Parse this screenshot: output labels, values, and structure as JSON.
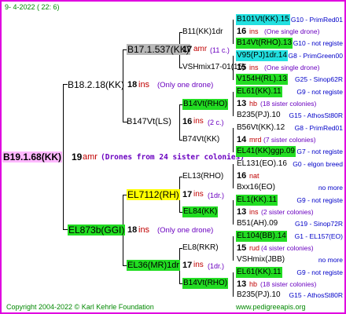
{
  "header": {
    "date": "9-  4-2022 ( 22:  6)"
  },
  "footer": {
    "copyright": "Copyright 2004-2022 © Karl Kehrle Foundation",
    "url": "www.pedigreeapis.org"
  },
  "root": {
    "name": "B19.1.68(KK)",
    "num": "19",
    "tag": "amr",
    "note": "(Drones from 24 sister colonies)"
  },
  "gen2": [
    {
      "name": "B18.2.18(KK)",
      "num": "18",
      "tag": "ins",
      "note": "(Only one drone)"
    },
    {
      "name": "EL873b(GGI)",
      "num": "18",
      "tag": "ins",
      "note": "(Only one drone)"
    }
  ],
  "gen3": [
    {
      "name": "B17.1.537(KK)",
      "num": "17",
      "tag": "amr",
      "note": "(11 c.)"
    },
    {
      "name": "B147Vt(LS)",
      "num": "16",
      "tag": "ins",
      "note": "(2 c.)"
    },
    {
      "name": "EL7112(RH)",
      "num": "17",
      "tag": "ins",
      "note": "(1dr.)"
    },
    {
      "name": "EL36(MR)1dr",
      "num": "17",
      "tag": "ins",
      "note": "(1dr.)"
    }
  ],
  "gen4": [
    {
      "name": "B11(KK)1dr"
    },
    {
      "name": "VSHmix17-01(15)"
    },
    {
      "name": "B14Vt(RHO)"
    },
    {
      "name": "B74Vt(KK)"
    },
    {
      "name": "EL13(RHO)"
    },
    {
      "name": "EL84(KK)"
    },
    {
      "name": "EL8(RKR)"
    },
    {
      "name": "B14Vt(RHO)"
    }
  ],
  "gen5": [
    {
      "name": "B101Vt(KK).15",
      "note": "G10 - PrimRed01"
    },
    {
      "num": "16",
      "tag": "ins",
      "note": "(One single drone)"
    },
    {
      "name": "B14Vt(RHO).13",
      "note": "G10 - not registe"
    },
    {
      "name": "V95(PJ)1dr.14",
      "note": "G8 - PrimGreen00"
    },
    {
      "num": "15",
      "tag": "ins",
      "note": "(One single drone)"
    },
    {
      "name": "V154H(RL).13",
      "note": "G25 - Sinop62R"
    },
    {
      "name": "EL61(KK).11",
      "note": "G9 - not registe"
    },
    {
      "num": "13",
      "tag": "hb",
      "note": "(18 sister colonies)"
    },
    {
      "name": "B235(PJ).10",
      "note": "G15 - AthosSt80R"
    },
    {
      "name": "B56Vt(KK).12",
      "note": "G8 - PrimRed01"
    },
    {
      "num": "14",
      "tag": "mrd",
      "note": "(7 sister colonies)"
    },
    {
      "name": "EL41(KK)ggp.09",
      "note": "G7 - not registe"
    },
    {
      "name": "EL131(EO).16",
      "note": "G0 - elgon breed"
    },
    {
      "num": "16",
      "tag": "nat",
      "note": ""
    },
    {
      "name": "Bxx16(EO)",
      "note": "no more"
    },
    {
      "name": "EL1(KK).11",
      "note": "G9 - not registe"
    },
    {
      "num": "13",
      "tag": "ins",
      "note": "(2 sister colonies)"
    },
    {
      "name": "B51(AH).09",
      "note": "G19 - Sinop72R"
    },
    {
      "name": "EL104(BB).14",
      "note": "G1 - EL157(EO)"
    },
    {
      "num": "15",
      "tag": "rud",
      "note": "(4 sister colonies)"
    },
    {
      "name": "VSHmix(JBB)",
      "note": "no more"
    },
    {
      "name": "EL61(KK).11",
      "note": "G9 - not registe"
    },
    {
      "num": "13",
      "tag": "hb",
      "note": "(18 sister colonies)"
    },
    {
      "name": "B235(PJ).10",
      "note": "G15 - AthosSt80R"
    }
  ]
}
